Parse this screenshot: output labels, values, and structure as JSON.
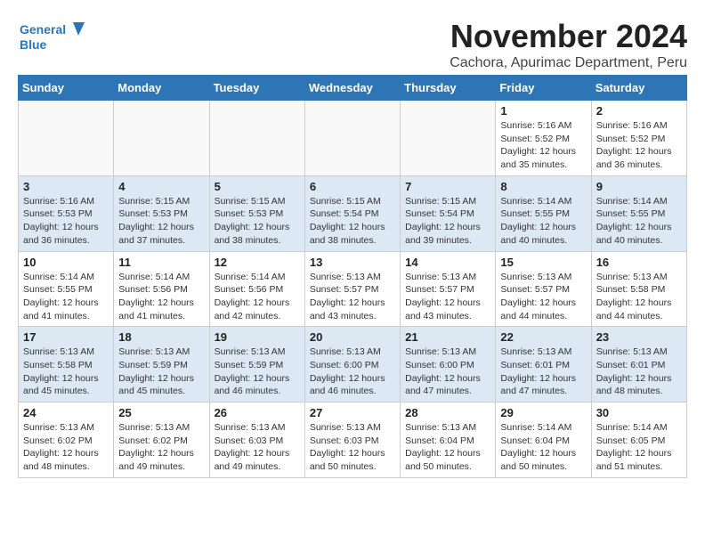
{
  "logo": {
    "line1": "General",
    "line2": "Blue"
  },
  "title": "November 2024",
  "subtitle": "Cachora, Apurimac Department, Peru",
  "days_of_week": [
    "Sunday",
    "Monday",
    "Tuesday",
    "Wednesday",
    "Thursday",
    "Friday",
    "Saturday"
  ],
  "weeks": [
    [
      {
        "num": "",
        "info": ""
      },
      {
        "num": "",
        "info": ""
      },
      {
        "num": "",
        "info": ""
      },
      {
        "num": "",
        "info": ""
      },
      {
        "num": "",
        "info": ""
      },
      {
        "num": "1",
        "info": "Sunrise: 5:16 AM\nSunset: 5:52 PM\nDaylight: 12 hours\nand 35 minutes."
      },
      {
        "num": "2",
        "info": "Sunrise: 5:16 AM\nSunset: 5:52 PM\nDaylight: 12 hours\nand 36 minutes."
      }
    ],
    [
      {
        "num": "3",
        "info": "Sunrise: 5:16 AM\nSunset: 5:53 PM\nDaylight: 12 hours\nand 36 minutes."
      },
      {
        "num": "4",
        "info": "Sunrise: 5:15 AM\nSunset: 5:53 PM\nDaylight: 12 hours\nand 37 minutes."
      },
      {
        "num": "5",
        "info": "Sunrise: 5:15 AM\nSunset: 5:53 PM\nDaylight: 12 hours\nand 38 minutes."
      },
      {
        "num": "6",
        "info": "Sunrise: 5:15 AM\nSunset: 5:54 PM\nDaylight: 12 hours\nand 38 minutes."
      },
      {
        "num": "7",
        "info": "Sunrise: 5:15 AM\nSunset: 5:54 PM\nDaylight: 12 hours\nand 39 minutes."
      },
      {
        "num": "8",
        "info": "Sunrise: 5:14 AM\nSunset: 5:55 PM\nDaylight: 12 hours\nand 40 minutes."
      },
      {
        "num": "9",
        "info": "Sunrise: 5:14 AM\nSunset: 5:55 PM\nDaylight: 12 hours\nand 40 minutes."
      }
    ],
    [
      {
        "num": "10",
        "info": "Sunrise: 5:14 AM\nSunset: 5:55 PM\nDaylight: 12 hours\nand 41 minutes."
      },
      {
        "num": "11",
        "info": "Sunrise: 5:14 AM\nSunset: 5:56 PM\nDaylight: 12 hours\nand 41 minutes."
      },
      {
        "num": "12",
        "info": "Sunrise: 5:14 AM\nSunset: 5:56 PM\nDaylight: 12 hours\nand 42 minutes."
      },
      {
        "num": "13",
        "info": "Sunrise: 5:13 AM\nSunset: 5:57 PM\nDaylight: 12 hours\nand 43 minutes."
      },
      {
        "num": "14",
        "info": "Sunrise: 5:13 AM\nSunset: 5:57 PM\nDaylight: 12 hours\nand 43 minutes."
      },
      {
        "num": "15",
        "info": "Sunrise: 5:13 AM\nSunset: 5:57 PM\nDaylight: 12 hours\nand 44 minutes."
      },
      {
        "num": "16",
        "info": "Sunrise: 5:13 AM\nSunset: 5:58 PM\nDaylight: 12 hours\nand 44 minutes."
      }
    ],
    [
      {
        "num": "17",
        "info": "Sunrise: 5:13 AM\nSunset: 5:58 PM\nDaylight: 12 hours\nand 45 minutes."
      },
      {
        "num": "18",
        "info": "Sunrise: 5:13 AM\nSunset: 5:59 PM\nDaylight: 12 hours\nand 45 minutes."
      },
      {
        "num": "19",
        "info": "Sunrise: 5:13 AM\nSunset: 5:59 PM\nDaylight: 12 hours\nand 46 minutes."
      },
      {
        "num": "20",
        "info": "Sunrise: 5:13 AM\nSunset: 6:00 PM\nDaylight: 12 hours\nand 46 minutes."
      },
      {
        "num": "21",
        "info": "Sunrise: 5:13 AM\nSunset: 6:00 PM\nDaylight: 12 hours\nand 47 minutes."
      },
      {
        "num": "22",
        "info": "Sunrise: 5:13 AM\nSunset: 6:01 PM\nDaylight: 12 hours\nand 47 minutes."
      },
      {
        "num": "23",
        "info": "Sunrise: 5:13 AM\nSunset: 6:01 PM\nDaylight: 12 hours\nand 48 minutes."
      }
    ],
    [
      {
        "num": "24",
        "info": "Sunrise: 5:13 AM\nSunset: 6:02 PM\nDaylight: 12 hours\nand 48 minutes."
      },
      {
        "num": "25",
        "info": "Sunrise: 5:13 AM\nSunset: 6:02 PM\nDaylight: 12 hours\nand 49 minutes."
      },
      {
        "num": "26",
        "info": "Sunrise: 5:13 AM\nSunset: 6:03 PM\nDaylight: 12 hours\nand 49 minutes."
      },
      {
        "num": "27",
        "info": "Sunrise: 5:13 AM\nSunset: 6:03 PM\nDaylight: 12 hours\nand 50 minutes."
      },
      {
        "num": "28",
        "info": "Sunrise: 5:13 AM\nSunset: 6:04 PM\nDaylight: 12 hours\nand 50 minutes."
      },
      {
        "num": "29",
        "info": "Sunrise: 5:14 AM\nSunset: 6:04 PM\nDaylight: 12 hours\nand 50 minutes."
      },
      {
        "num": "30",
        "info": "Sunrise: 5:14 AM\nSunset: 6:05 PM\nDaylight: 12 hours\nand 51 minutes."
      }
    ]
  ]
}
